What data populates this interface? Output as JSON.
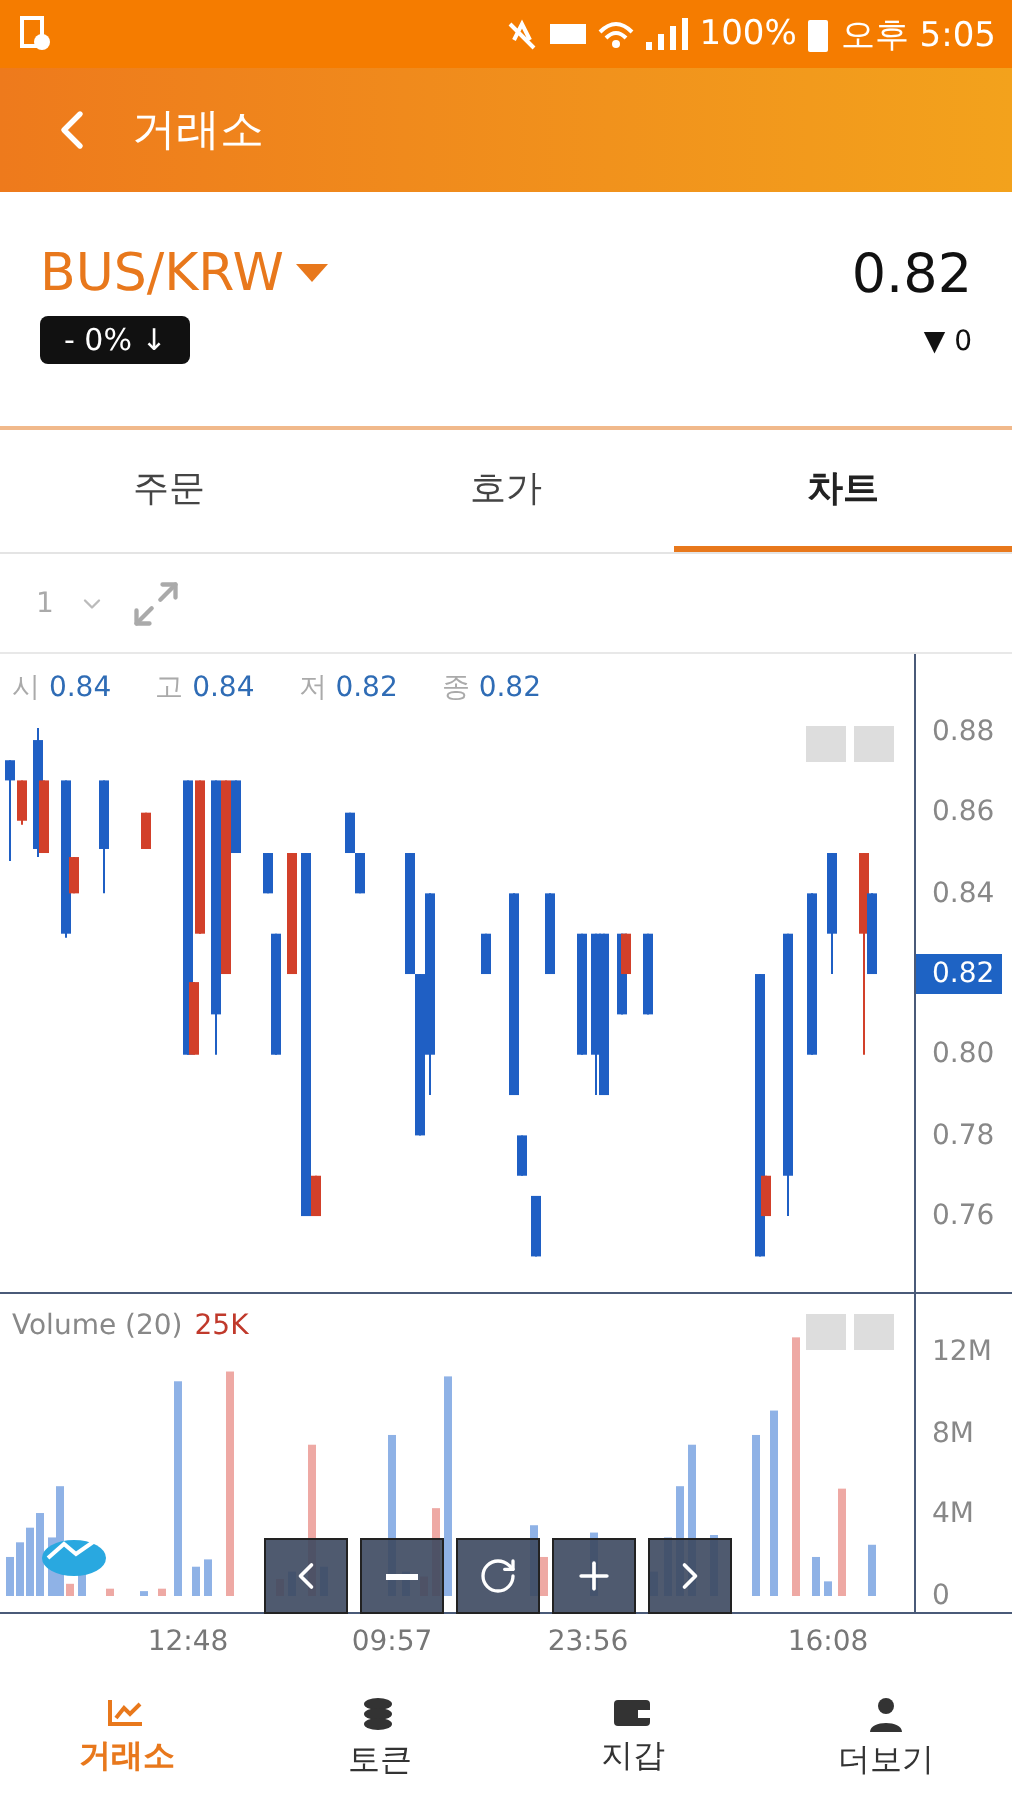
{
  "status_bar": {
    "battery": "100%",
    "time": "오후 5:05"
  },
  "header": {
    "title": "거래소"
  },
  "market": {
    "pair": "BUS/KRW",
    "change_badge": "- 0% ↓",
    "price": "0.82",
    "delta_arrow": "▼",
    "delta": "0"
  },
  "tabs": [
    {
      "label": "주문",
      "selected": false
    },
    {
      "label": "호가",
      "selected": false
    },
    {
      "label": "차트",
      "selected": true
    }
  ],
  "chart_toolbar": {
    "interval": "1"
  },
  "price_pane": {
    "legend": [
      {
        "key": "시",
        "value": "0.84"
      },
      {
        "key": "고",
        "value": "0.84"
      },
      {
        "key": "저",
        "value": "0.82"
      },
      {
        "key": "종",
        "value": "0.82"
      }
    ],
    "y_ticks": [
      {
        "label": "0.88",
        "current": false
      },
      {
        "label": "0.86",
        "current": false
      },
      {
        "label": "0.84",
        "current": false
      },
      {
        "label": "0.82",
        "current": true
      },
      {
        "label": "0.80",
        "current": false
      },
      {
        "label": "0.78",
        "current": false
      },
      {
        "label": "0.76",
        "current": false
      }
    ]
  },
  "volume_pane": {
    "title": "Volume (20)",
    "value": "25K",
    "y_ticks": [
      "12M",
      "8M",
      "4M",
      "0"
    ]
  },
  "x_ticks": [
    "12:48",
    "09:57",
    "23:56",
    "16:08"
  ],
  "bottom_nav": [
    {
      "label": "거래소",
      "kind": "exchange",
      "selected": true
    },
    {
      "label": "토큰",
      "kind": "token",
      "selected": false
    },
    {
      "label": "지갑",
      "kind": "wallet",
      "selected": false
    },
    {
      "label": "더보기",
      "kind": "more",
      "selected": false
    }
  ]
}
